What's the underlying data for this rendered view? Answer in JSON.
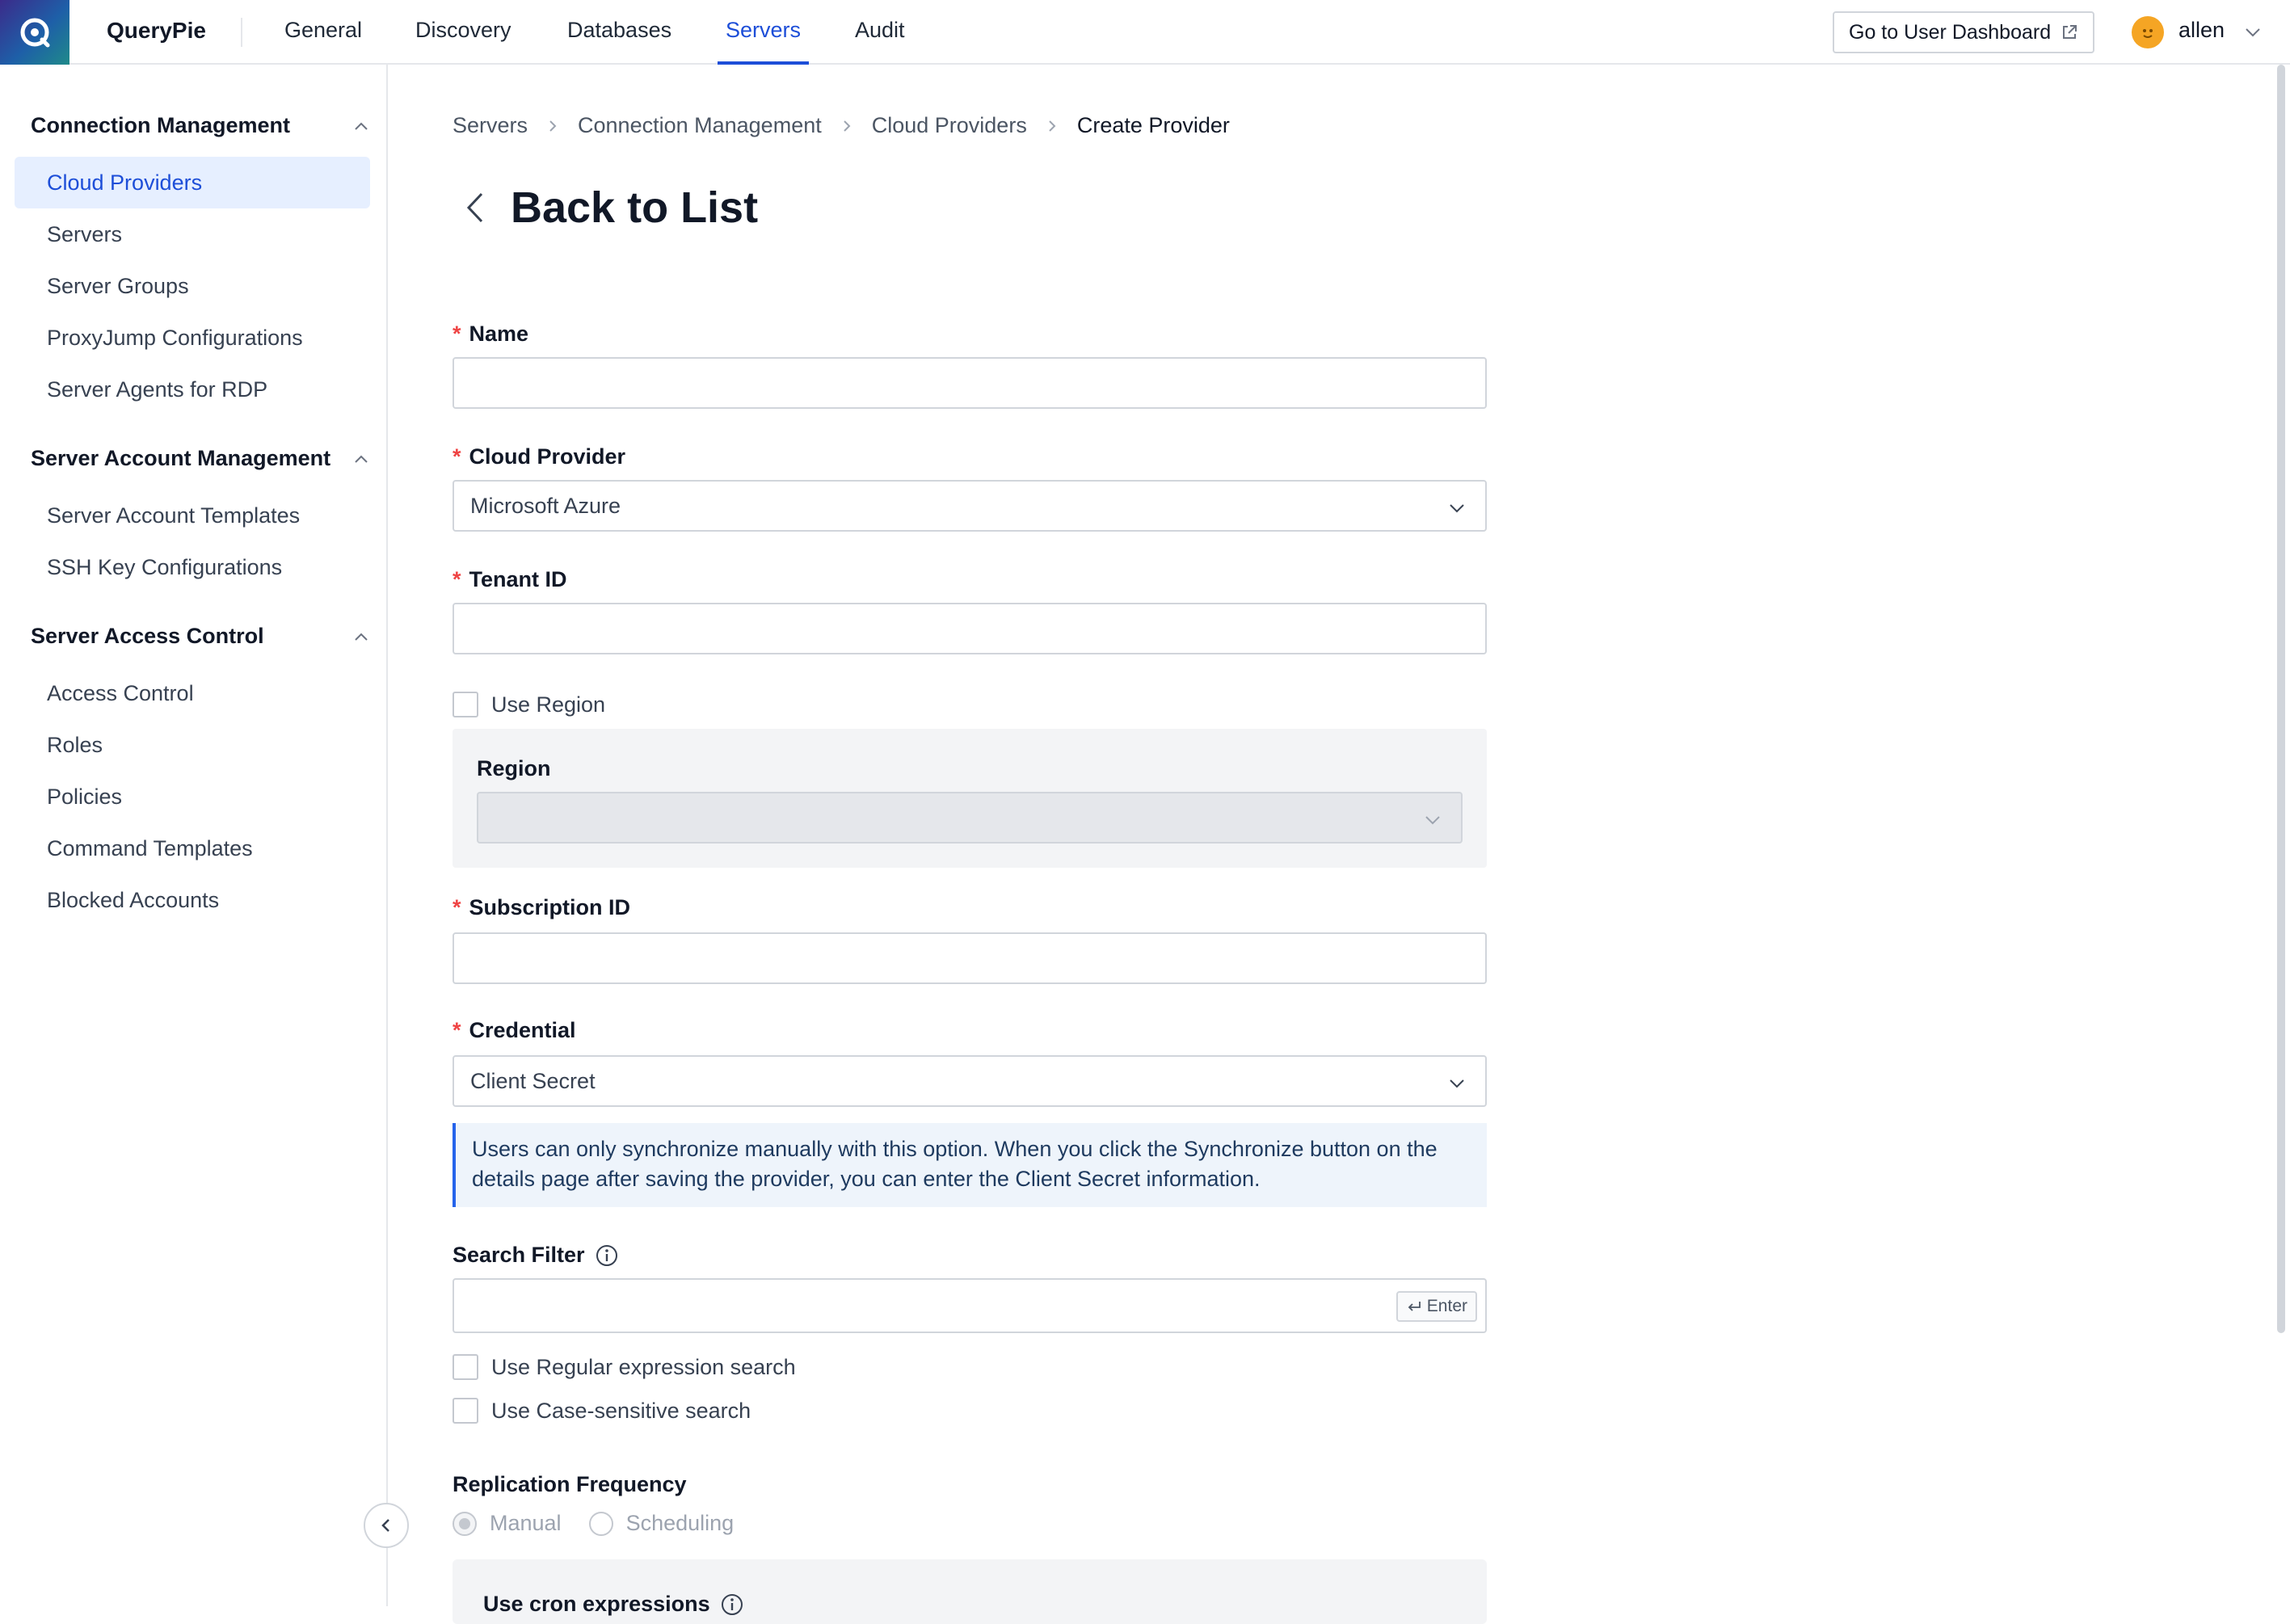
{
  "app": {
    "title": "QueryPie"
  },
  "nav": {
    "tabs": [
      {
        "label": "General"
      },
      {
        "label": "Discovery"
      },
      {
        "label": "Databases"
      },
      {
        "label": "Servers"
      },
      {
        "label": "Audit"
      }
    ],
    "active_tab": "Servers",
    "dashboard_button": "Go to User Dashboard",
    "user": "allen"
  },
  "sidebar": {
    "sections": [
      {
        "title": "Connection Management",
        "items": [
          "Cloud Providers",
          "Servers",
          "Server Groups",
          "ProxyJump Configurations",
          "Server Agents for RDP"
        ]
      },
      {
        "title": "Server Account Management",
        "items": [
          "Server Account Templates",
          "SSH Key Configurations"
        ]
      },
      {
        "title": "Server Access Control",
        "items": [
          "Access Control",
          "Roles",
          "Policies",
          "Command Templates",
          "Blocked Accounts"
        ]
      }
    ],
    "active_item": "Cloud Providers"
  },
  "breadcrumb": [
    "Servers",
    "Connection Management",
    "Cloud Providers",
    "Create Provider"
  ],
  "page": {
    "back_title": "Back to List"
  },
  "form": {
    "required_mark": "*",
    "name": {
      "label": "Name",
      "value": ""
    },
    "cloud_provider": {
      "label": "Cloud Provider",
      "value": "Microsoft Azure"
    },
    "tenant_id": {
      "label": "Tenant ID",
      "value": ""
    },
    "use_region": {
      "label": "Use Region",
      "checked": false
    },
    "region": {
      "label": "Region",
      "value": ""
    },
    "subscription_id": {
      "label": "Subscription ID",
      "value": ""
    },
    "credential": {
      "label": "Credential",
      "value": "Client Secret"
    },
    "credential_info": "Users can only synchronize manually with this option. When you click the Synchronize button on the details page after saving the provider, you can enter the Client Secret information.",
    "search_filter": {
      "label": "Search Filter",
      "value": "",
      "enter_hint": "Enter"
    },
    "regex_search": {
      "label": "Use Regular expression search",
      "checked": false
    },
    "case_search": {
      "label": "Use Case-sensitive search",
      "checked": false
    },
    "replication": {
      "label": "Replication Frequency",
      "options": [
        "Manual",
        "Scheduling"
      ],
      "selected": "Manual"
    },
    "cron": {
      "label": "Use cron expressions"
    }
  },
  "colors": {
    "accent": "#1d4ed8",
    "active_bg": "#e6efff",
    "required": "#ef4444",
    "info_bg": "#eef4fb"
  }
}
